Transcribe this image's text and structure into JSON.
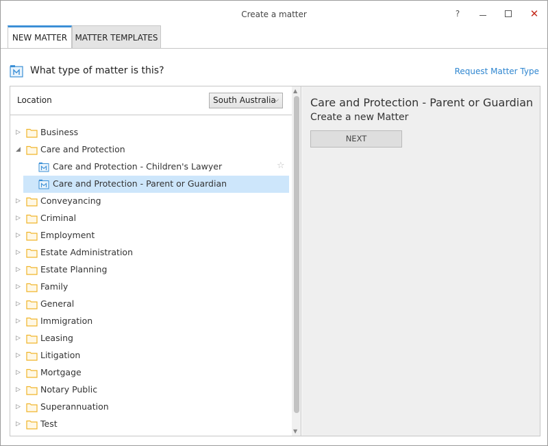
{
  "window": {
    "title": "Create a matter",
    "help": "?",
    "close": "✕"
  },
  "tabs": [
    {
      "label": "NEW MATTER",
      "active": true
    },
    {
      "label": "MATTER TEMPLATES",
      "active": false
    }
  ],
  "question": {
    "text": "What type of matter is this?",
    "request_link": "Request Matter Type"
  },
  "location": {
    "label": "Location",
    "selected": "South Australia"
  },
  "tree": [
    {
      "label": "Business",
      "type": "folder",
      "expanded": false
    },
    {
      "label": "Care and Protection",
      "type": "folder",
      "expanded": true
    },
    {
      "label": "Care and Protection - Children's Lawyer",
      "type": "matter"
    },
    {
      "label": "Care and Protection - Parent or Guardian",
      "type": "matter",
      "selected": true
    },
    {
      "label": "Conveyancing",
      "type": "folder"
    },
    {
      "label": "Criminal",
      "type": "folder"
    },
    {
      "label": "Employment",
      "type": "folder"
    },
    {
      "label": "Estate Administration",
      "type": "folder"
    },
    {
      "label": "Estate Planning",
      "type": "folder"
    },
    {
      "label": "Family",
      "type": "folder"
    },
    {
      "label": "General",
      "type": "folder"
    },
    {
      "label": "Immigration",
      "type": "folder"
    },
    {
      "label": "Leasing",
      "type": "folder"
    },
    {
      "label": "Litigation",
      "type": "folder"
    },
    {
      "label": "Mortgage",
      "type": "folder"
    },
    {
      "label": "Notary Public",
      "type": "folder"
    },
    {
      "label": "Superannuation",
      "type": "folder"
    },
    {
      "label": "Test",
      "type": "folder"
    }
  ],
  "details": {
    "title": "Care and Protection - Parent or Guardian",
    "subtitle": "Create a new Matter",
    "next_label": "NEXT"
  },
  "icons": {
    "folder": "folder-icon",
    "matter": "matter-icon",
    "star": "star-icon",
    "expand": "expand-arrow-icon"
  },
  "colors": {
    "accent": "#3b8fd6",
    "link": "#2f86d0",
    "selection": "#cde6fb",
    "folder": "#f0b429",
    "close": "#c42b1c"
  }
}
